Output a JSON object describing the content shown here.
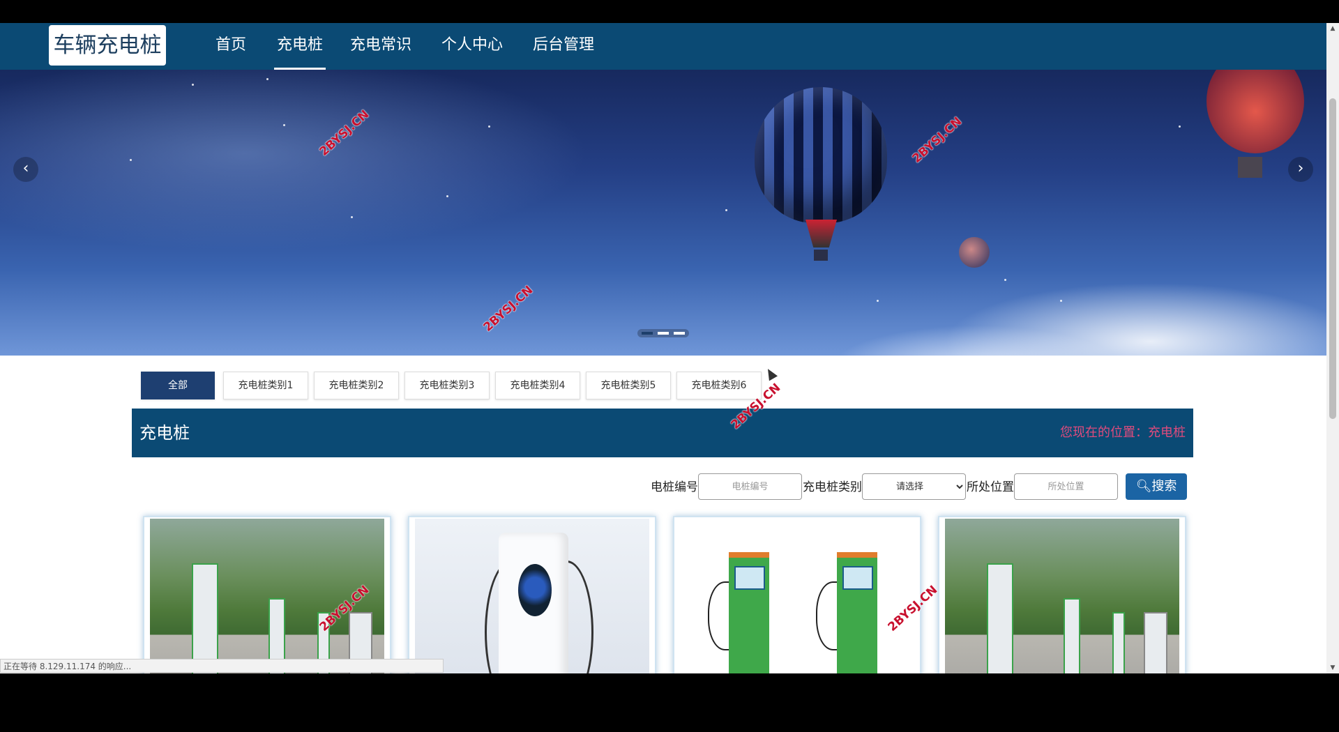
{
  "nav": {
    "logo": "车辆充电桩",
    "items": [
      {
        "label": "首页"
      },
      {
        "label": "充电桩"
      },
      {
        "label": "充电常识"
      },
      {
        "label": "个人中心"
      },
      {
        "label": "后台管理"
      }
    ],
    "active_index": 1
  },
  "carousel": {
    "prev": "‹",
    "next": "›",
    "slide_count": 3,
    "active_slide": 0
  },
  "categories": [
    "全部",
    "充电桩类别1",
    "充电桩类别2",
    "充电桩类别3",
    "充电桩类别4",
    "充电桩类别5",
    "充电桩类别6"
  ],
  "section": {
    "title": "充电桩",
    "breadcrumb_prefix": "您现在的位置：",
    "breadcrumb_current": "充电桩"
  },
  "search": {
    "code_label": "电桩编号",
    "code_placeholder": "电桩编号",
    "type_label": "充电桩类别",
    "type_selected": "请选择",
    "location_label": "所处位置",
    "location_placeholder": "所处位置",
    "button": "搜索"
  },
  "watermark": "2BYSJ.CN",
  "status_bar": "正在等待 8.129.11.174 的响应...",
  "colors": {
    "nav_bg": "#0b4a74",
    "active_category": "#1e3f71",
    "breadcrumb": "#e04b7d",
    "search_button": "#1b64a4"
  }
}
